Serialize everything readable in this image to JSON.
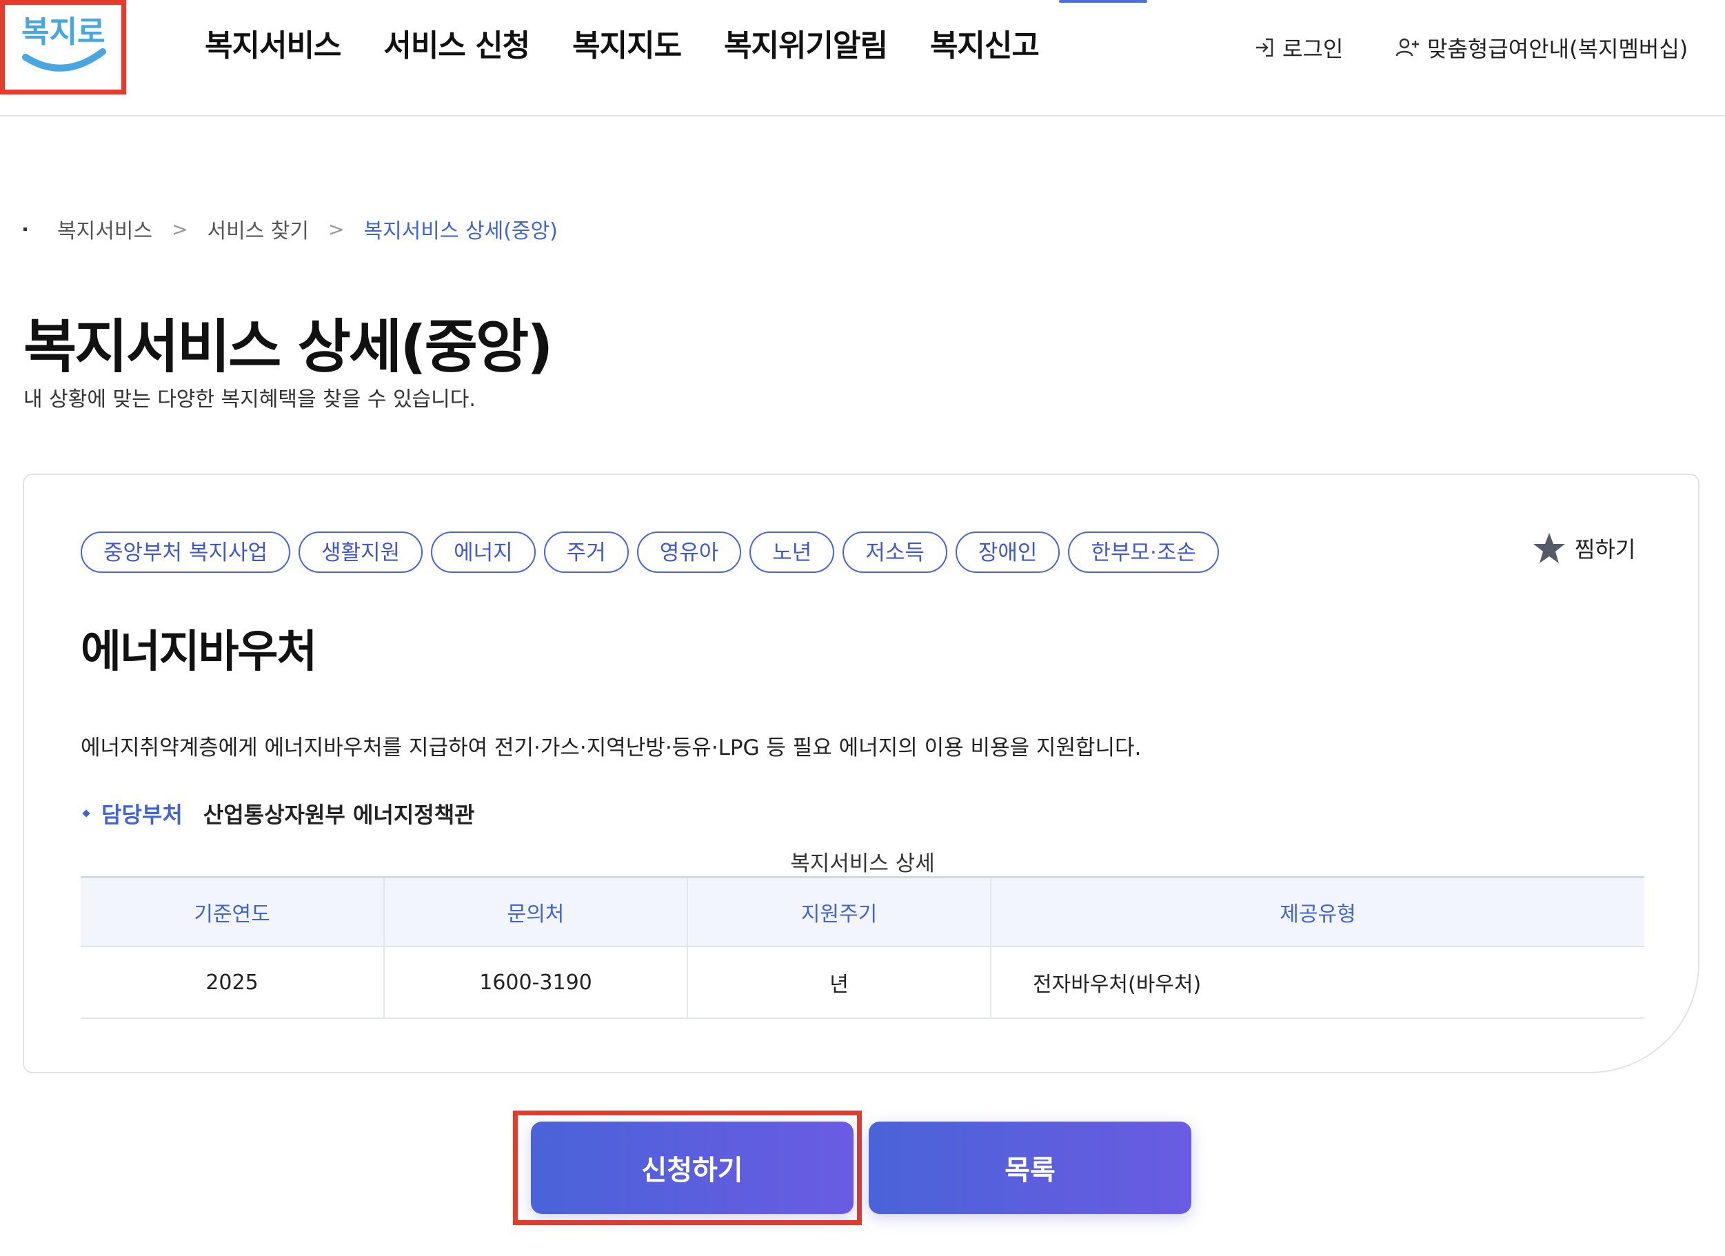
{
  "header": {
    "logo_text": "복지로",
    "nav": [
      "복지서비스",
      "서비스 신청",
      "복지지도",
      "복지위기알림",
      "복지신고"
    ],
    "login_label": "로그인",
    "membership_label": "맞춤형급여안내(복지멤버십)"
  },
  "breadcrumb": [
    "복지서비스",
    "서비스 찾기",
    "복지서비스 상세(중앙)"
  ],
  "page": {
    "title": "복지서비스 상세(중앙)",
    "description": "내 상황에 맞는 다양한 복지혜택을 찾을 수 있습니다."
  },
  "service": {
    "tags": [
      "중앙부처 복지사업",
      "생활지원",
      "에너지",
      "주거",
      "영유아",
      "노년",
      "저소득",
      "장애인",
      "한부모·조손"
    ],
    "favorite_label": "찜하기",
    "title": "에너지바우처",
    "description": "에너지취약계층에게 에너지바우처를 지급하여 전기·가스·지역난방·등유·LPG 등 필요 에너지의 이용 비용을 지원합니다.",
    "dept_label": "담당부처",
    "dept_value": "산업통상자원부 에너지정책관",
    "table": {
      "caption": "복지서비스 상세",
      "headers": [
        "기준연도",
        "문의처",
        "지원주기",
        "제공유형"
      ],
      "row": [
        "2025",
        "1600-3190",
        "년",
        "전자바우처(바우처)"
      ]
    }
  },
  "buttons": {
    "apply": "신청하기",
    "list": "목록"
  },
  "colors": {
    "accent": "#4263d6",
    "highlight": "#e53b2c",
    "button_gradient_start": "#4a63d8",
    "button_gradient_end": "#6a5be3"
  }
}
